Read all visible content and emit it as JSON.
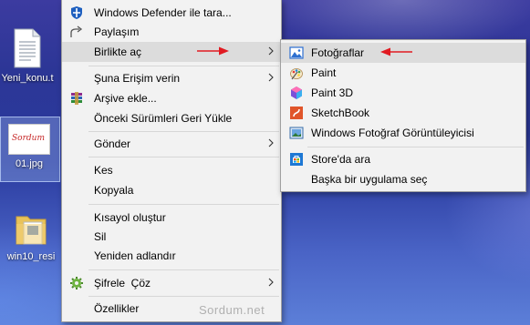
{
  "desktop": {
    "icons": [
      {
        "label": "Yeni_konu.t",
        "name": "text-document-icon"
      },
      {
        "label": "01.jpg",
        "name": "image-file-icon",
        "thumb_text": "Sordum"
      },
      {
        "label": "win10_resi",
        "name": "zip-folder-icon"
      }
    ]
  },
  "context_menu": {
    "items": [
      {
        "label": "Windows Defender ile tara...",
        "icon": "defender-shield-icon"
      },
      {
        "label": "Paylaşım",
        "icon": "share-icon"
      },
      {
        "label": "Birlikte aç",
        "icon": "",
        "submenu": true
      },
      {
        "label": "Şuna Erişim verin",
        "icon": "",
        "submenu": true
      },
      {
        "label": "Arşive ekle...",
        "icon": "winrar-archive-icon"
      },
      {
        "label": "Önceki Sürümleri Geri Yükle",
        "icon": ""
      },
      {
        "label": "Gönder",
        "icon": "",
        "submenu": true
      },
      {
        "label": "Kes",
        "icon": ""
      },
      {
        "label": "Kopyala",
        "icon": ""
      },
      {
        "label": "Kısayol oluştur",
        "icon": ""
      },
      {
        "label": "Sil",
        "icon": ""
      },
      {
        "label": "Yeniden adlandır",
        "icon": ""
      },
      {
        "label": "Şifrele  Çöz",
        "icon": "encrypt-gear-icon",
        "submenu": true
      },
      {
        "label": "Özellikler",
        "icon": ""
      }
    ]
  },
  "submenu": {
    "items": [
      {
        "label": "Fotoğraflar",
        "icon": "photos-app-icon"
      },
      {
        "label": "Paint",
        "icon": "paint-app-icon"
      },
      {
        "label": "Paint 3D",
        "icon": "paint-3d-icon"
      },
      {
        "label": "SketchBook",
        "icon": "sketchbook-icon"
      },
      {
        "label": "Windows Fotoğraf Görüntüleyicisi",
        "icon": "windows-photo-viewer-icon"
      },
      {
        "label": "Store'da ara",
        "icon": "store-icon"
      },
      {
        "label": "Başka bir uygulama seç",
        "icon": ""
      }
    ]
  },
  "watermark": "Sordum.net",
  "colors": {
    "arrow": "#e11b22",
    "menu_bg": "#f2f2f2",
    "highlight": "#dcdcdc"
  }
}
